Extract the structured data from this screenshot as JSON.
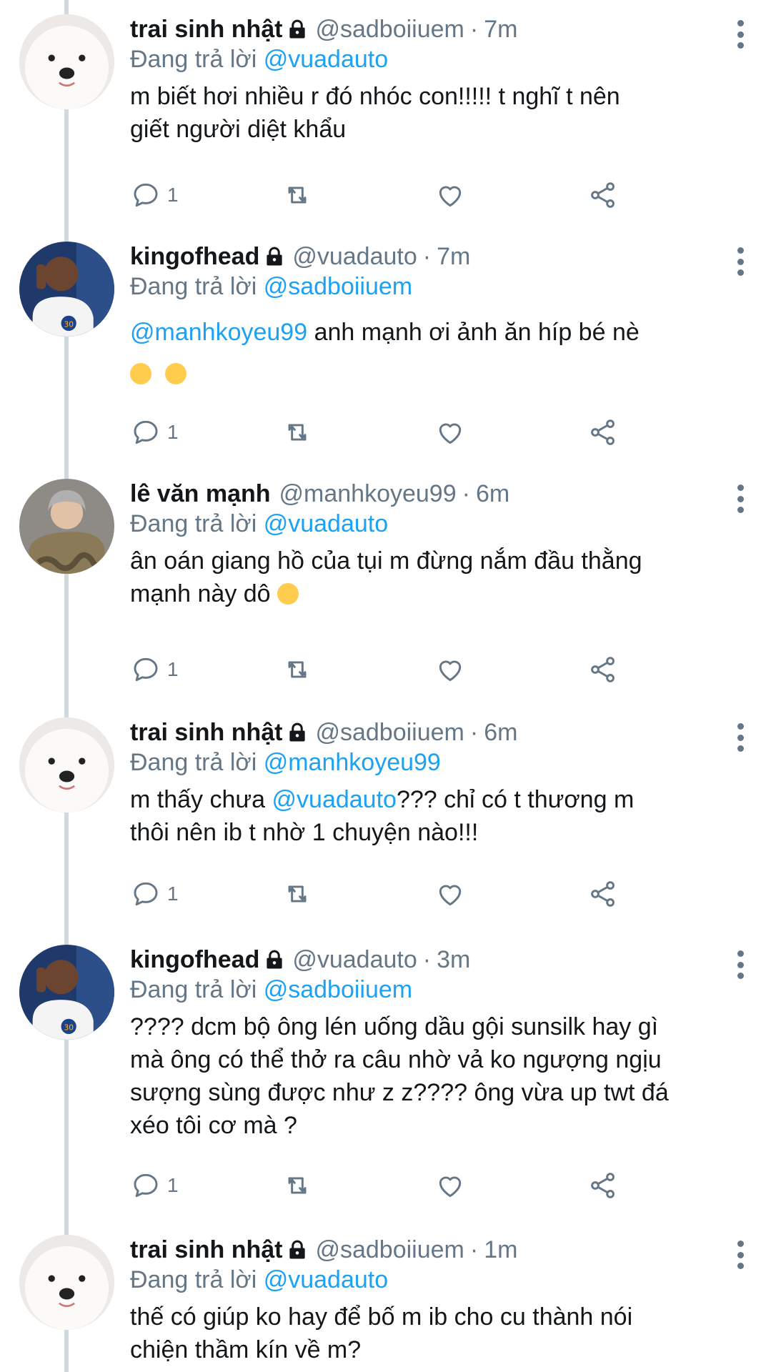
{
  "reply_prefix": "Đang trả lời",
  "colors": {
    "link": "#1da1f2",
    "muted": "#657786",
    "text": "#14171a",
    "thread_line": "#cfd9de"
  },
  "icons": {
    "reply": "comment-icon",
    "retweet": "retweet-icon",
    "like": "heart-icon",
    "share": "share-icon",
    "more": "more-vertical-icon",
    "lock": "lock-icon"
  },
  "tweets": [
    {
      "name": "trai sinh nhật",
      "locked": true,
      "handle": "@sadboiiuem",
      "time": "7m",
      "replying_to": "@vuadauto",
      "text_line1": "m biết hơi nhiều r đó nhóc con!!!!! t nghĩ t nên",
      "text_line2": "giết người diệt khẩu",
      "reply_count": "1",
      "avatar": "white-dog-avatar"
    },
    {
      "name": "kingofhead",
      "locked": true,
      "handle": "@vuadauto",
      "time": "7m",
      "replying_to": "@sadboiiuem",
      "mention": "@manhkoyeu99",
      "text_line1": " anh mạnh ơi ảnh ăn híp bé nè",
      "emojis": [
        "loudly-crying-face-emoji",
        "pleading-face-emoji"
      ],
      "reply_count": "1",
      "avatar": "basketball-player-avatar"
    },
    {
      "name": "lê văn mạnh",
      "locked": false,
      "handle": "@manhkoyeu99",
      "time": "6m",
      "replying_to": "@vuadauto",
      "text_line1": "ân oán giang hồ của tụi m đừng nắm đầu thằng",
      "text_line2": "mạnh này dô",
      "emojis": [
        "grinning-squinting-face-emoji"
      ],
      "reply_count": "1",
      "avatar": "person-camo-jacket-avatar"
    },
    {
      "name": "trai sinh nhật",
      "locked": true,
      "handle": "@sadboiiuem",
      "time": "6m",
      "replying_to": "@manhkoyeu99",
      "text_pre": "m thấy chưa ",
      "mention": "@vuadauto",
      "text_post": "??? chỉ có t thương m",
      "text_line2": "thôi nên ib t nhờ 1 chuyện nào!!!",
      "reply_count": "1",
      "avatar": "white-dog-avatar"
    },
    {
      "name": "kingofhead",
      "locked": true,
      "handle": "@vuadauto",
      "time": "3m",
      "replying_to": "@sadboiiuem",
      "text_line1": "???? dcm bộ ông lén uống dầu gội sunsilk hay gì",
      "text_line2": "mà ông có thể thở ra câu nhờ vả ko ngượng ngịu",
      "text_line3": "sượng sùng được như z z???? ông vừa up twt đá",
      "text_line4": "xéo tôi cơ mà ?",
      "reply_count": "1",
      "avatar": "basketball-player-avatar"
    },
    {
      "name": "trai sinh nhật",
      "locked": true,
      "handle": "@sadboiiuem",
      "time": "1m",
      "replying_to": "@vuadauto",
      "text_line1": "thế có giúp ko hay để bố m ib cho cu thành nói",
      "text_line2": "chiện thầm kín về m?",
      "avatar": "white-dog-avatar"
    }
  ]
}
